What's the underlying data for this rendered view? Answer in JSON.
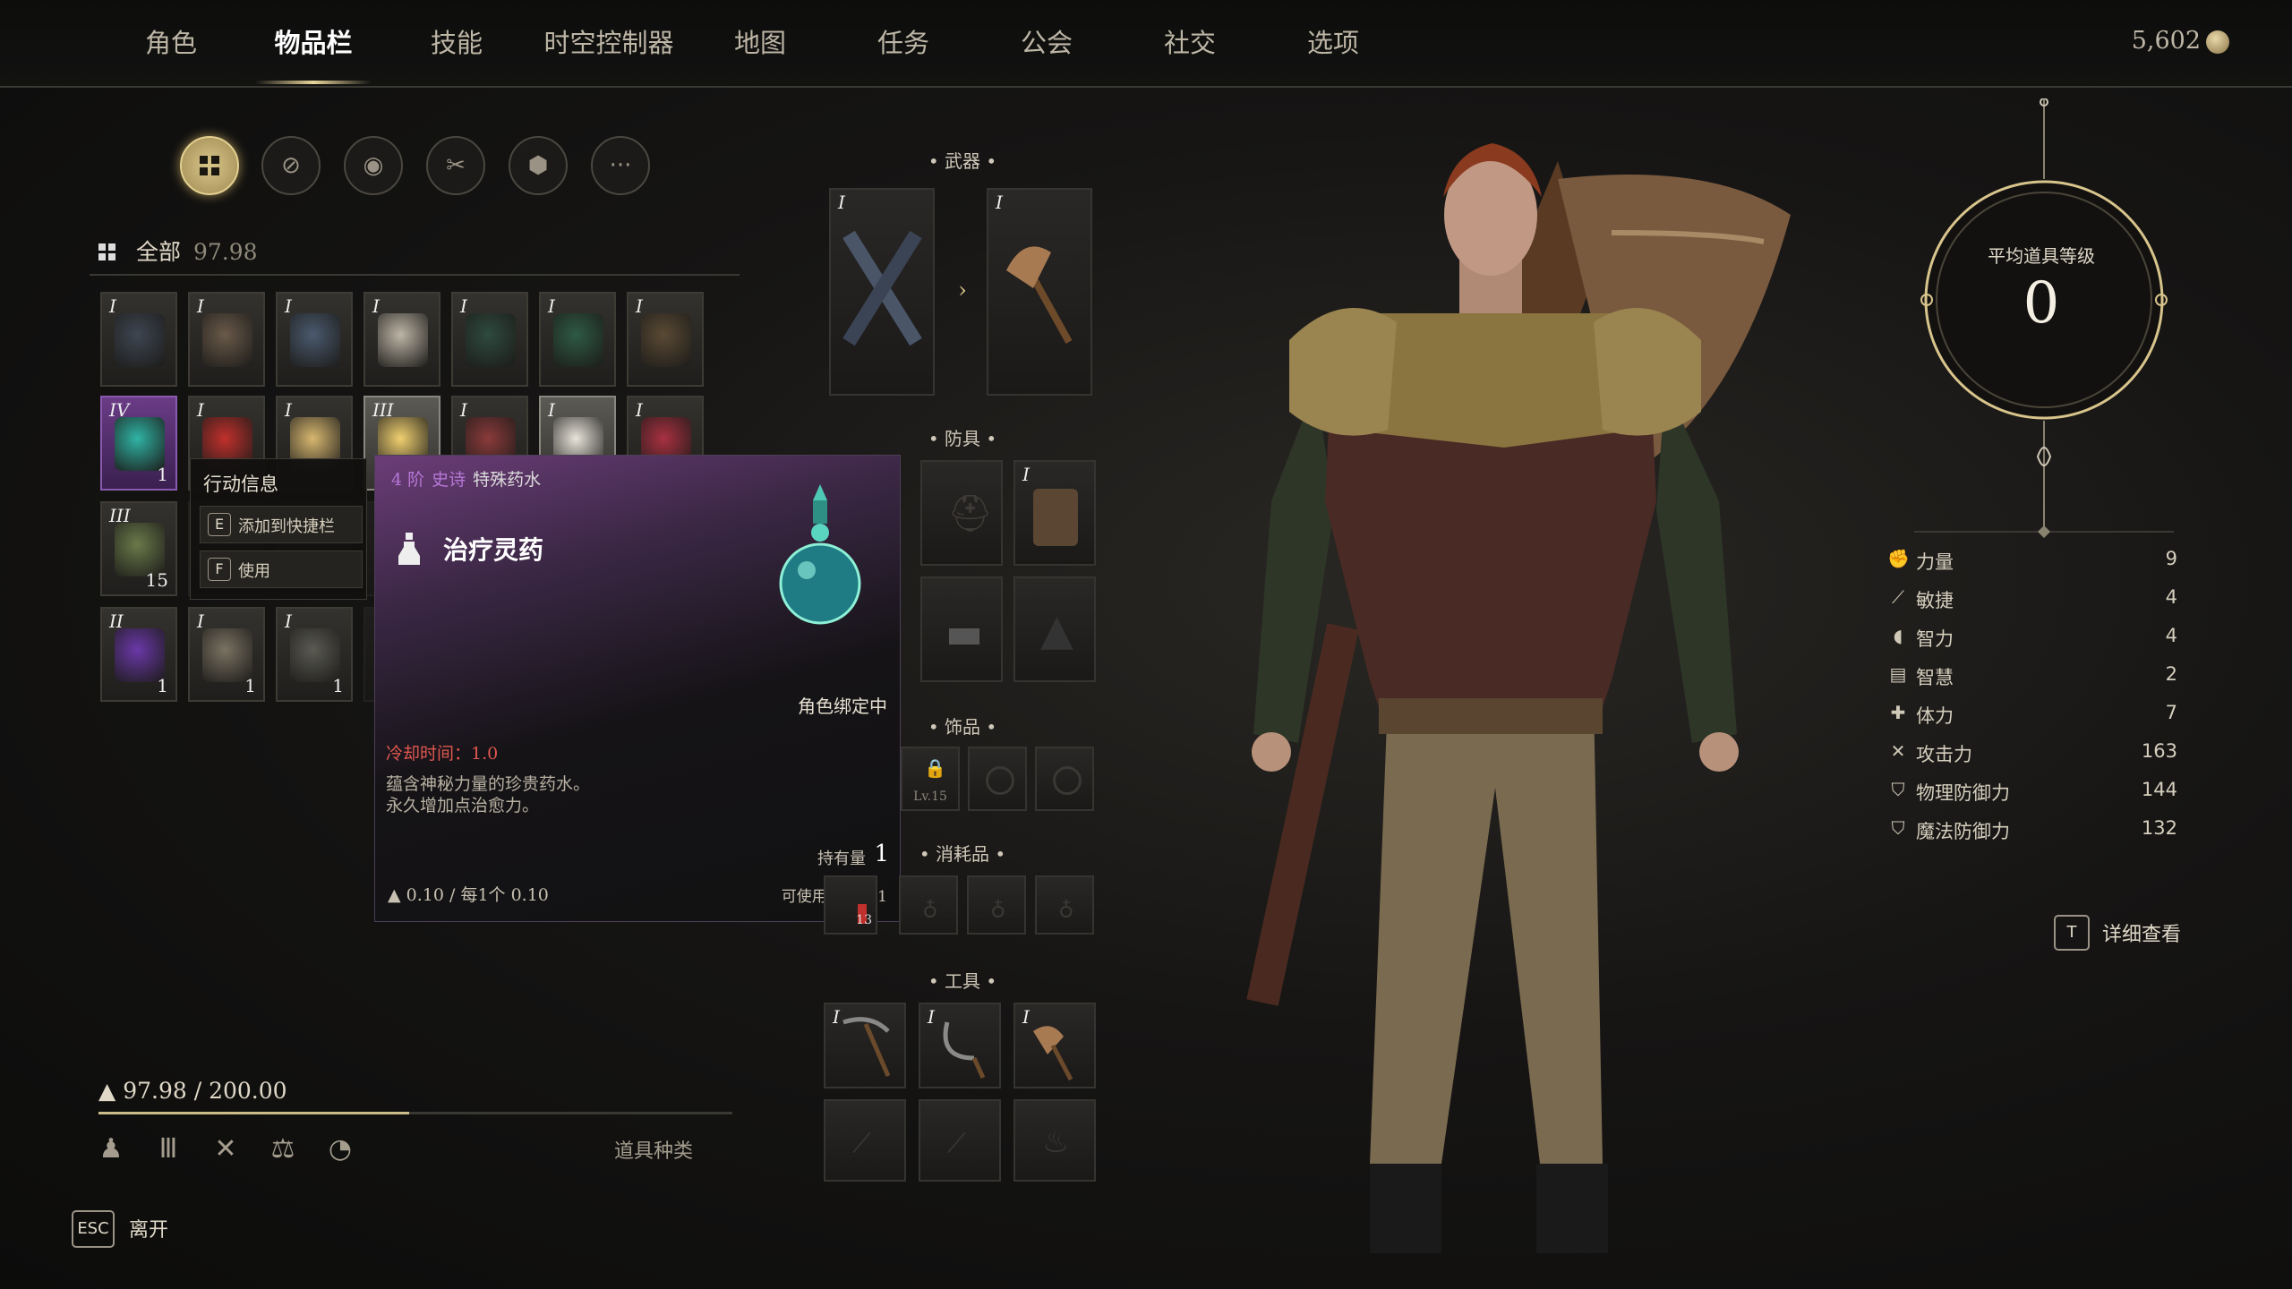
{
  "nav": {
    "tabs": [
      "角色",
      "物品栏",
      "技能",
      "时空控制器",
      "地图",
      "任务",
      "公会",
      "社交",
      "选项"
    ],
    "active": "物品栏",
    "currency": "5,602"
  },
  "filters": [
    "all-grid",
    "armor",
    "accessory",
    "crafting",
    "box",
    "more"
  ],
  "category": {
    "label": "全部",
    "weight": "97.98"
  },
  "inventory": [
    [
      {
        "tier": "I",
        "art": "crossed-swords"
      },
      {
        "tier": "I",
        "art": "axes"
      },
      {
        "tier": "I",
        "art": "axes-blue"
      },
      {
        "tier": "I",
        "art": "mask"
      },
      {
        "tier": "I",
        "art": "green-vest"
      },
      {
        "tier": "I",
        "art": "green-vest-2"
      },
      {
        "tier": "I",
        "art": "shorts"
      }
    ],
    [
      {
        "tier": "IV",
        "art": "potion",
        "count": "1",
        "style": "purple"
      },
      {
        "tier": "I",
        "art": "red-vial"
      },
      {
        "tier": "I",
        "art": "soup"
      },
      {
        "tier": "III",
        "art": "fruit",
        "style": "bright"
      },
      {
        "tier": "I",
        "art": "meat"
      },
      {
        "tier": "I",
        "art": "feather",
        "style": "bright"
      },
      {
        "tier": "I",
        "art": "berries"
      }
    ],
    [
      {
        "tier": "III",
        "art": "herb",
        "count": "15"
      },
      {
        "tier": "",
        "art": ""
      },
      {
        "tier": "",
        "art": ""
      },
      {
        "tier": "",
        "art": ""
      },
      {
        "tier": "",
        "art": ""
      },
      {
        "tier": "",
        "art": ""
      },
      {
        "tier": "",
        "art": ""
      }
    ],
    [
      {
        "tier": "II",
        "art": "purple-ore",
        "count": "1"
      },
      {
        "tier": "I",
        "art": "cloth",
        "count": "1"
      },
      {
        "tier": "I",
        "art": "scrap",
        "count": "1"
      },
      {
        "tier": "",
        "art": ""
      },
      {
        "tier": "",
        "art": ""
      },
      {
        "tier": "",
        "art": ""
      },
      {
        "tier": "",
        "art": ""
      }
    ]
  ],
  "action_menu": {
    "title": "行动信息",
    "items": [
      {
        "key": "E",
        "label": "添加到快捷栏"
      },
      {
        "key": "F",
        "label": "使用"
      }
    ]
  },
  "tooltip": {
    "tier": "4 阶",
    "rarity": "史诗",
    "type": "特殊药水",
    "name": "治疗灵药",
    "bound": "角色绑定中",
    "cooldown": "冷却时间：1.0",
    "desc1": "蕴含神秘力量的珍贵药水。",
    "desc2": "永久增加点治愈力。",
    "hold_label": "持有量",
    "hold_value": "1",
    "weight": "0.10  /  每1个  0.10",
    "level": "可使用等级： 1"
  },
  "equipment": {
    "weapon_title": "武器",
    "armor_title": "防具",
    "accessory_title": "饰品",
    "consumable_title": "消耗品",
    "tool_title": "工具",
    "ring_lock": "Lv.15",
    "consumable_count": "13"
  },
  "footer": {
    "weight": "97.98 / 200.00",
    "weight_fraction": 0.49,
    "sort_label": "道具种类",
    "esc_key": "ESC",
    "esc_label": "离开"
  },
  "stats": {
    "gear_title": "平均道具等级",
    "gear_value": "0",
    "items": [
      {
        "name": "力量",
        "value": "9",
        "icon": "fist-icon"
      },
      {
        "name": "敏捷",
        "value": "4",
        "icon": "boot-icon"
      },
      {
        "name": "智力",
        "value": "4",
        "icon": "head-icon"
      },
      {
        "name": "智慧",
        "value": "2",
        "icon": "book-icon"
      },
      {
        "name": "体力",
        "value": "7",
        "icon": "cross-icon"
      },
      {
        "name": "攻击力",
        "value": "163",
        "icon": "swords-icon"
      },
      {
        "name": "物理防御力",
        "value": "144",
        "icon": "shield-icon"
      },
      {
        "name": "魔法防御力",
        "value": "132",
        "icon": "magic-shield-icon"
      }
    ],
    "detail_key": "T",
    "detail_label": "详细查看"
  }
}
